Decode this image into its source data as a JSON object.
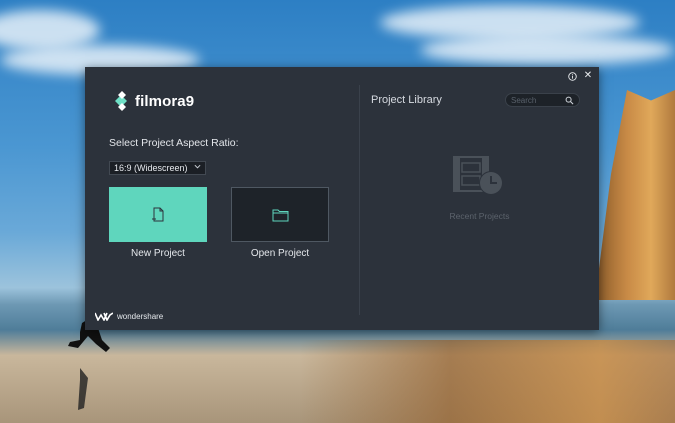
{
  "window": {
    "info_icon": "info-circle-icon",
    "close_label": "✕"
  },
  "app": {
    "name": "filmora",
    "version": "9",
    "logo_icon": "filmora-logo-icon",
    "accent_color": "#5fd6bd"
  },
  "start": {
    "aspect_label": "Select Project Aspect Ratio:",
    "aspect_value": "16:9 (Widescreen)",
    "new_project_label": "New Project",
    "new_project_icon": "new-file-icon",
    "open_project_label": "Open Project",
    "open_project_icon": "folder-icon"
  },
  "library": {
    "title": "Project Library",
    "search_placeholder": "Search",
    "empty_label": "Recent Projects",
    "empty_icon": "film-clock-icon"
  },
  "footer": {
    "brand": "wondershare",
    "brand_icon": "wondershare-logo-icon"
  }
}
